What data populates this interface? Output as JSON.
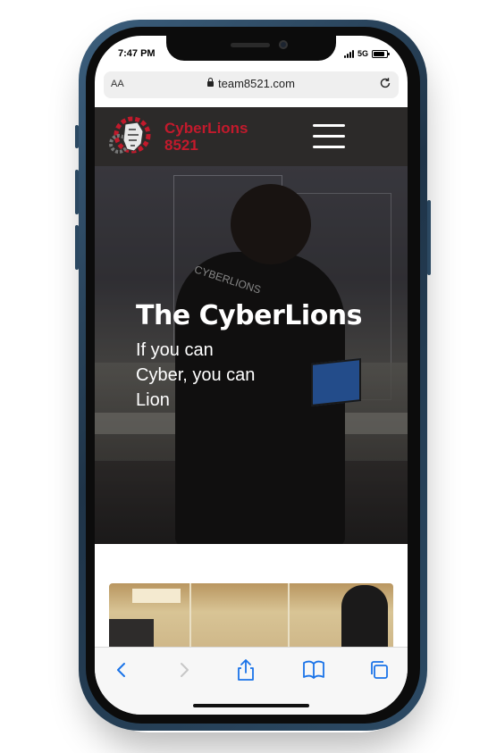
{
  "status_bar": {
    "time": "7:47 PM",
    "network": "5G"
  },
  "browser": {
    "aa_label": "AA",
    "url": "team8521.com"
  },
  "header": {
    "brand_line1": "CyberLions",
    "brand_line2": "8521",
    "brand_color": "#c21a2c"
  },
  "hero": {
    "title": "The CyberLions",
    "subtitle": "If you can Cyber, you can Lion",
    "shirt_text": "CYBERLIONS"
  },
  "toolbar": {
    "icons": [
      "back-icon",
      "forward-icon",
      "share-icon",
      "bookmarks-icon",
      "tabs-icon"
    ],
    "accent": "#1a73e8"
  }
}
